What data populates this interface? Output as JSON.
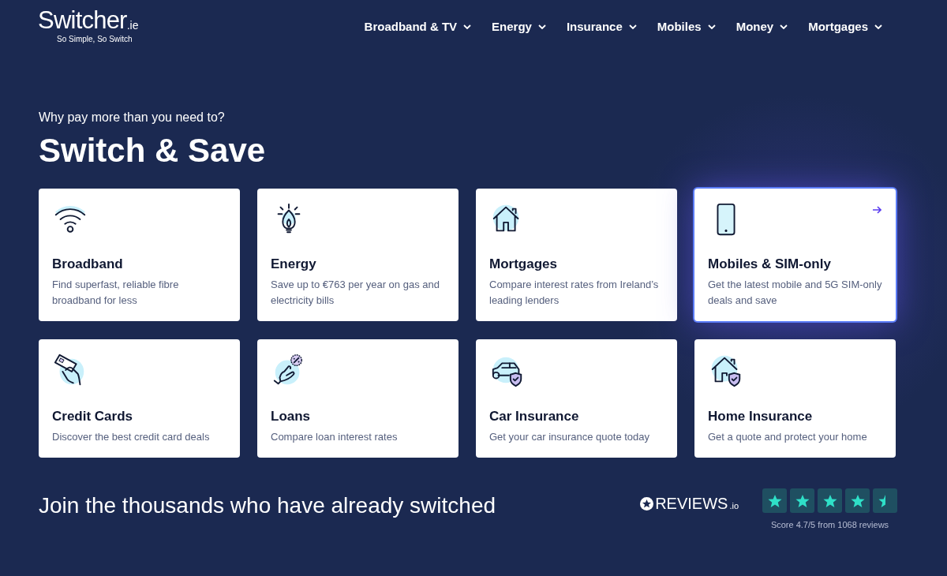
{
  "logo": {
    "name": "Switcher",
    "suffix": ".ie",
    "tagline": "So Simple, So Switch"
  },
  "nav": [
    {
      "label": "Broadband & TV"
    },
    {
      "label": "Energy"
    },
    {
      "label": "Insurance"
    },
    {
      "label": "Mobiles"
    },
    {
      "label": "Money"
    },
    {
      "label": "Mortgages"
    }
  ],
  "hero": {
    "eyebrow": "Why pay more than you need to?",
    "title": "Switch & Save"
  },
  "cards": [
    {
      "title": "Broadband",
      "description": "Find superfast, reliable fibre broadband for less",
      "selected": false
    },
    {
      "title": "Energy",
      "description": "Save up to €763 per year on gas and electricity bills",
      "selected": false
    },
    {
      "title": "Mortgages",
      "description": "Compare interest rates from Ireland’s leading lenders",
      "selected": false
    },
    {
      "title": "Mobiles & SIM-only",
      "description": "Get the latest mobile and 5G SIM-only deals and save",
      "selected": true
    },
    {
      "title": "Credit Cards",
      "description": "Discover the best credit card deals",
      "selected": false
    },
    {
      "title": "Loans",
      "description": "Compare loan interest rates",
      "selected": false
    },
    {
      "title": "Car Insurance",
      "description": "Get your car insurance quote today",
      "selected": false
    },
    {
      "title": "Home Insurance",
      "description": "Get a quote and protect your home",
      "selected": false
    }
  ],
  "join": {
    "text": "Join the thousands who have already switched"
  },
  "reviews": {
    "brand": "REVIEWS",
    "brand_suffix": ".io",
    "stars": 4.5,
    "score": "Score 4.7/5 from 1068 reviews"
  }
}
